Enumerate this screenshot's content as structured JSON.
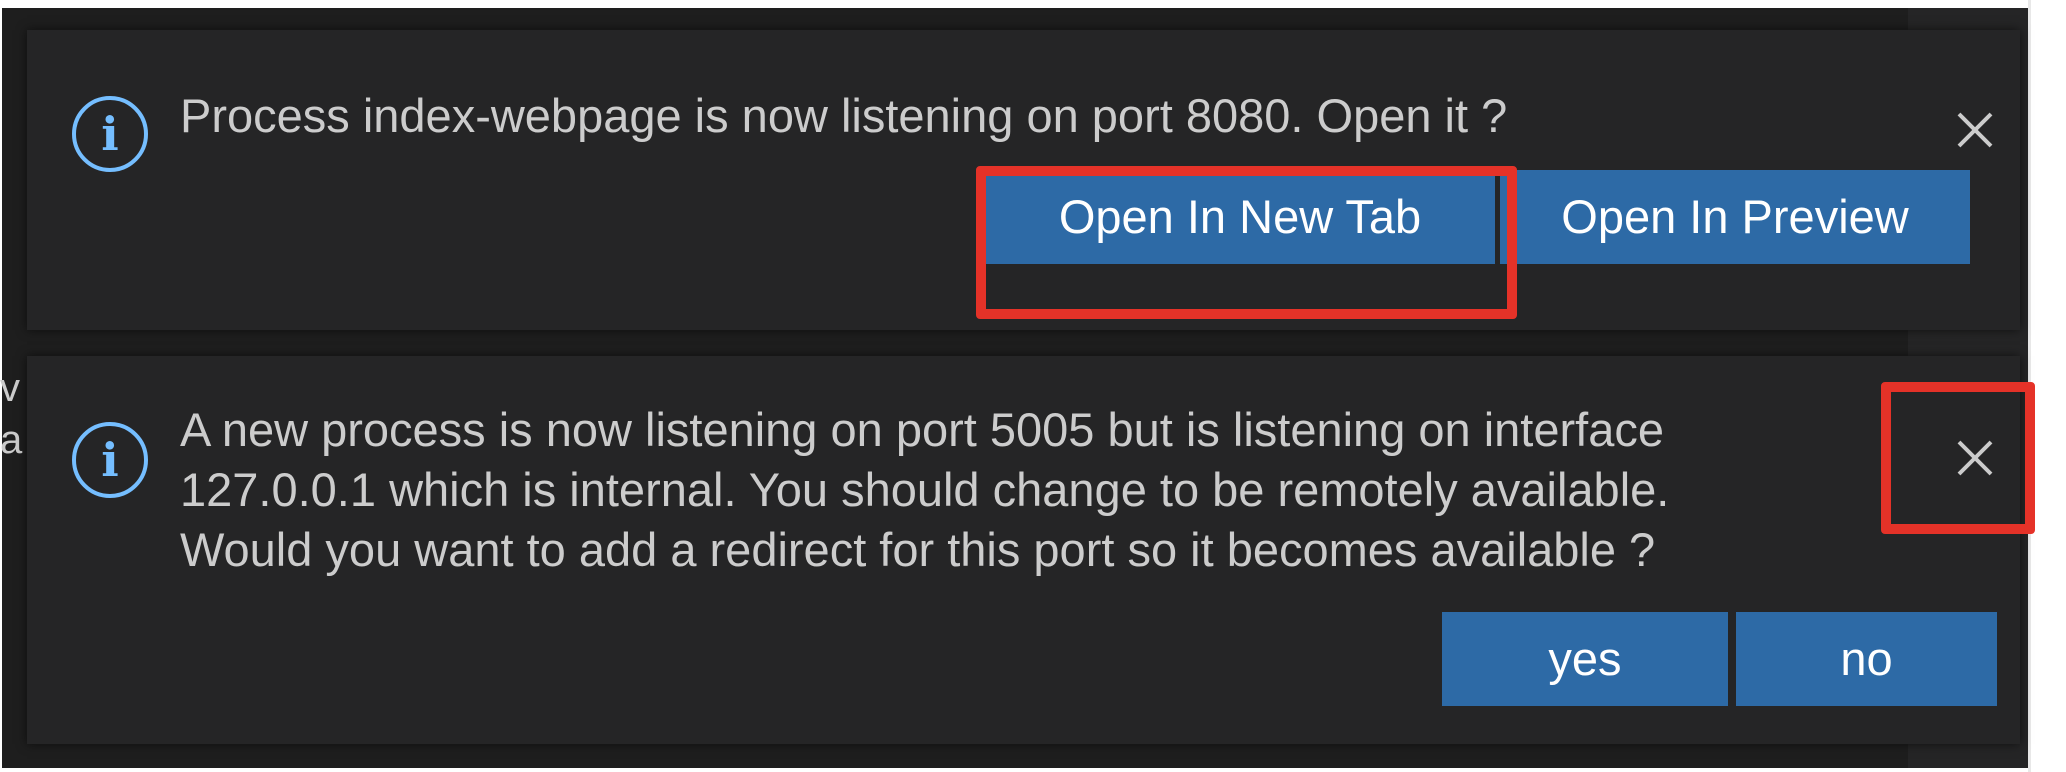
{
  "background_peek": {
    "line1": "v",
    "line2": "a"
  },
  "notifications": [
    {
      "icon": "info-icon",
      "icon_glyph": "i",
      "message_lines": [
        "Process index-webpage is now listening on port 8080. Open it ?"
      ],
      "close_glyph": "×",
      "actions": [
        {
          "label": "Open In New Tab"
        },
        {
          "label": "Open In Preview"
        }
      ]
    },
    {
      "icon": "info-icon",
      "icon_glyph": "i",
      "message_lines": [
        "A new process is now listening on port 5005 but is listening on interface",
        "127.0.0.1 which is internal. You should change to be remotely available.",
        "Would you want to add a redirect for this port so it becomes available ?"
      ],
      "close_glyph": "×",
      "actions": [
        {
          "label": "yes"
        },
        {
          "label": "no"
        }
      ]
    }
  ],
  "colors": {
    "toast_background": "#252526",
    "editor_background": "#1e1e1e",
    "info_icon": "#75beff",
    "button_background": "#2d6aa6",
    "highlight_annotation": "#e53228",
    "text": "#cccccc"
  }
}
